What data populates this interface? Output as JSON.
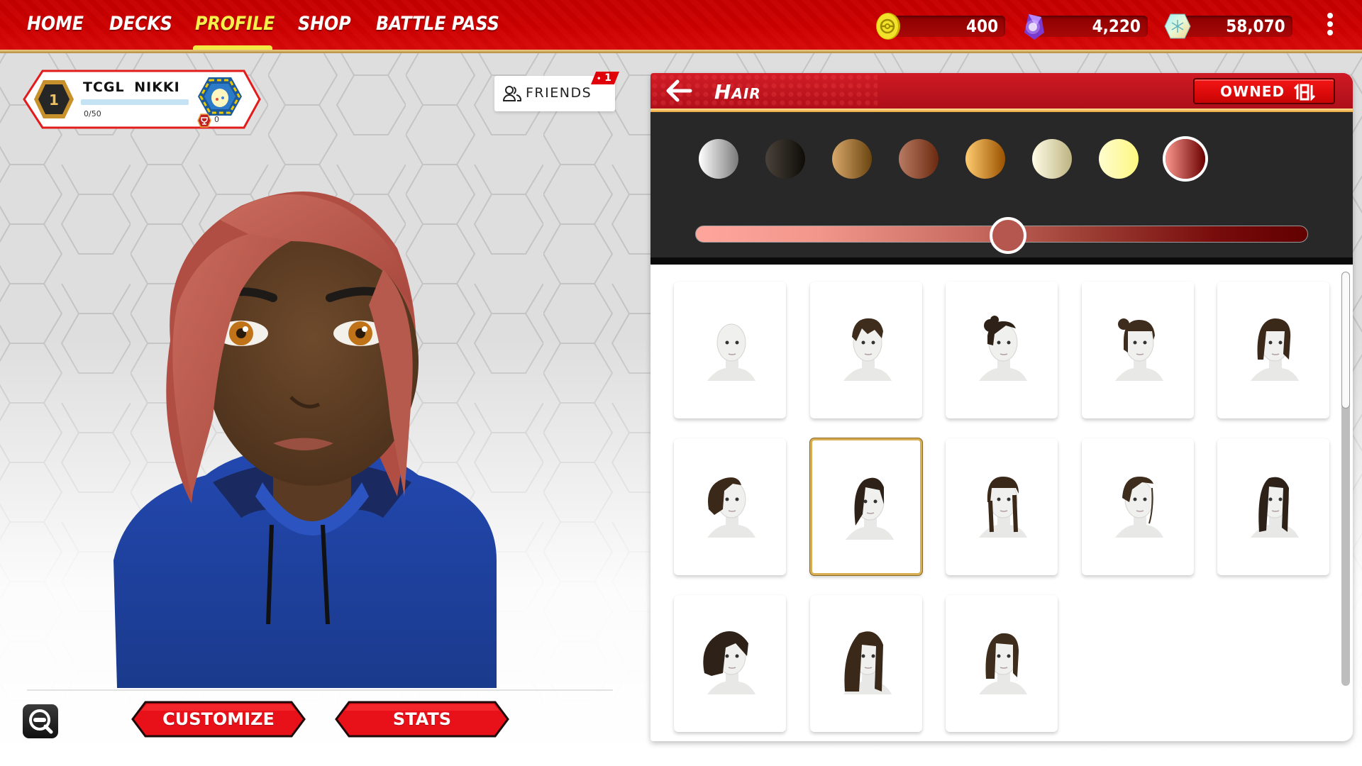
{
  "nav": {
    "items": [
      {
        "label": "HOME",
        "active": false
      },
      {
        "label": "DECKS",
        "active": false
      },
      {
        "label": "PROFILE",
        "active": true
      },
      {
        "label": "SHOP",
        "active": false
      },
      {
        "label": "BATTLE PASS",
        "active": false
      }
    ]
  },
  "currencies": [
    {
      "name": "coins",
      "icon": "pokecoin-icon",
      "value": "400"
    },
    {
      "name": "crystal-shards",
      "icon": "purple-crystal-icon",
      "value": "4,220"
    },
    {
      "name": "gems",
      "icon": "rainbow-gem-icon",
      "value": "58,070"
    }
  ],
  "profile": {
    "level": "1",
    "name": "TCGL  NIKKI",
    "xp_text": "0/50",
    "xp_progress": 0,
    "trophy_count": "0"
  },
  "friends": {
    "label": "FRIENDS",
    "notification_count": "1"
  },
  "bottom_actions": {
    "customize_label": "CUSTOMIZE",
    "stats_label": "STATS"
  },
  "panel": {
    "title": "Hair",
    "filter_label": "OWNED",
    "swatches": [
      {
        "name": "silver",
        "from": "#ffffff",
        "to": "#7a7a7a",
        "selected": false
      },
      {
        "name": "black",
        "from": "#4a423a",
        "to": "#0e0c08",
        "selected": false
      },
      {
        "name": "light-brown",
        "from": "#d8a86a",
        "to": "#6a4410",
        "selected": false
      },
      {
        "name": "auburn",
        "from": "#b87a62",
        "to": "#6a2a10",
        "selected": false
      },
      {
        "name": "golden",
        "from": "#ffcc70",
        "to": "#9a5200",
        "selected": false
      },
      {
        "name": "cream",
        "from": "#fffce6",
        "to": "#bdb482",
        "selected": false
      },
      {
        "name": "pale-yellow",
        "from": "#fffcd0",
        "to": "#fdf880",
        "selected": false
      },
      {
        "name": "red",
        "from": "#f8968c",
        "to": "#6a0000",
        "selected": true
      }
    ],
    "shade_value": 0.51,
    "styles": [
      {
        "name": "bald",
        "hair": "none",
        "selected": false
      },
      {
        "name": "pixie",
        "hair": "pixie",
        "selected": false
      },
      {
        "name": "curly-updo",
        "hair": "updo",
        "selected": false
      },
      {
        "name": "bun-bangs",
        "hair": "bun",
        "selected": false
      },
      {
        "name": "bob-bangs",
        "hair": "bob",
        "selected": false
      },
      {
        "name": "twists",
        "hair": "twists",
        "selected": false
      },
      {
        "name": "side-swept",
        "hair": "side",
        "selected": true
      },
      {
        "name": "braids-bangs",
        "hair": "braids",
        "selected": false
      },
      {
        "name": "cornrow-updo",
        "hair": "cornrow",
        "selected": false
      },
      {
        "name": "long-straight",
        "hair": "long",
        "selected": false
      },
      {
        "name": "curly-updo-large",
        "hair": "curls",
        "selected": false
      },
      {
        "name": "long-wavy",
        "hair": "wavy",
        "selected": false
      },
      {
        "name": "a-line-bob",
        "hair": "aline",
        "selected": false
      }
    ],
    "scroll_position": 0
  }
}
